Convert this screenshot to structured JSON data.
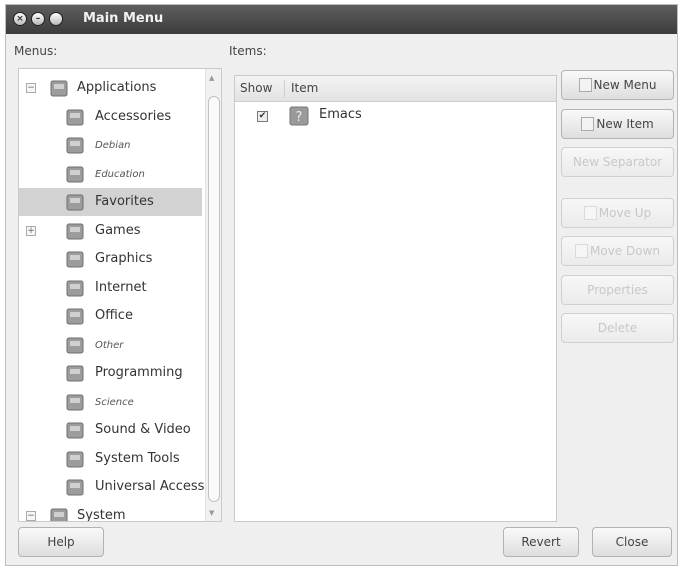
{
  "window": {
    "title": "Main Menu"
  },
  "labels": {
    "menus": "Menus:",
    "items": "Items:"
  },
  "tree": [
    {
      "label": "Applications",
      "icon": "applications-icon",
      "expander": "−",
      "italic": false
    },
    {
      "label": "Accessories",
      "icon": "accessories-icon",
      "italic": false
    },
    {
      "label": "Debian",
      "icon": "debian-icon",
      "italic": true
    },
    {
      "label": "Education",
      "icon": "education-icon",
      "italic": true
    },
    {
      "label": "Favorites",
      "icon": "favorites-icon",
      "italic": false,
      "selected": true
    },
    {
      "label": "Games",
      "icon": "games-icon",
      "expander": "+",
      "italic": false
    },
    {
      "label": "Graphics",
      "icon": "graphics-icon",
      "italic": false
    },
    {
      "label": "Internet",
      "icon": "internet-icon",
      "italic": false
    },
    {
      "label": "Office",
      "icon": "office-icon",
      "italic": false
    },
    {
      "label": "Other",
      "icon": "other-icon",
      "italic": true
    },
    {
      "label": "Programming",
      "icon": "programming-icon",
      "italic": false
    },
    {
      "label": "Science",
      "icon": "science-icon",
      "italic": true
    },
    {
      "label": "Sound & Video",
      "icon": "sound-video-icon",
      "italic": false
    },
    {
      "label": "System Tools",
      "icon": "system-tools-icon",
      "italic": false
    },
    {
      "label": "Universal Access",
      "icon": "universal-access-icon",
      "italic": false
    },
    {
      "label": "System",
      "icon": "system-icon",
      "expander": "−",
      "italic": false
    }
  ],
  "items_table": {
    "columns": [
      "Show",
      "Item"
    ],
    "rows": [
      {
        "show": true,
        "icon": "emacs-icon",
        "name": "Emacs"
      }
    ]
  },
  "buttons": {
    "new_menu": "New Menu",
    "new_item": "New Item",
    "new_separator": "New Separator",
    "move_up": "Move Up",
    "move_down": "Move Down",
    "properties": "Properties",
    "delete": "Delete",
    "help": "Help",
    "revert": "Revert",
    "close": "Close"
  },
  "colors": {
    "titlebar": "#4a4a4a",
    "selection": "#d2d2d2",
    "window_bg": "#efefef"
  }
}
